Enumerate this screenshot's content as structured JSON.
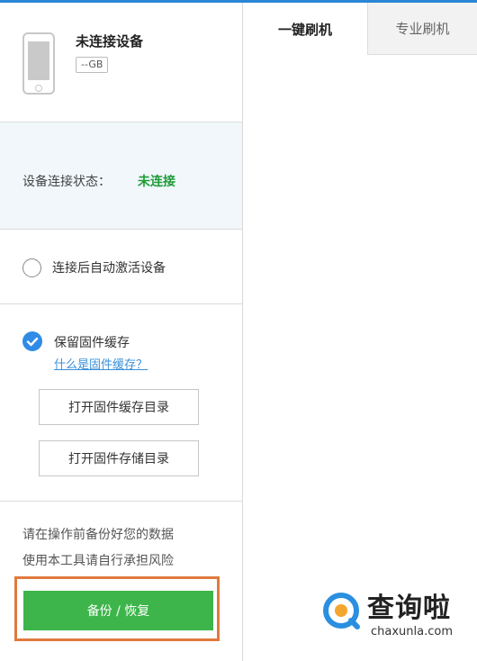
{
  "device": {
    "name": "未连接设备",
    "capacity": "--GB"
  },
  "status": {
    "label": "设备连接状态：",
    "value": "未连接",
    "value_color": "#1e9b38"
  },
  "options": {
    "auto_activate_label": "连接后自动激活设备",
    "keep_firmware_label": "保留固件缓存",
    "keep_firmware_checked": true,
    "what_is_cache_link": "什么是固件缓存？",
    "open_cache_dir_button": "打开固件缓存目录",
    "open_storage_dir_button": "打开固件存储目录"
  },
  "warnings": {
    "line1": "请在操作前备份好您的数据",
    "line2": "使用本工具请自行承担风险"
  },
  "backup_button": "备份 / 恢复",
  "tabs": [
    {
      "label": "一键刷机",
      "active": true
    },
    {
      "label": "专业刷机",
      "active": false
    }
  ],
  "watermark": {
    "title": "查询啦",
    "url": "chaxunla.com"
  },
  "colors": {
    "accent": "#2f8be6",
    "primary_button": "#3db54a",
    "highlight": "#e07a3e"
  }
}
